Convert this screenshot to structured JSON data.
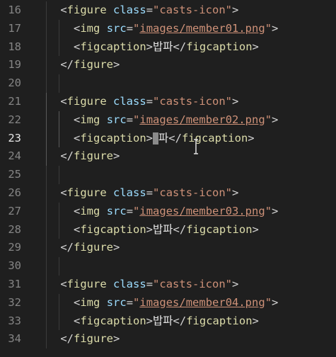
{
  "editor": {
    "active_line": 23,
    "lines": [
      {
        "number": "16",
        "indent": "    ",
        "parts": [
          [
            "bracket",
            "<"
          ],
          [
            "tag",
            "figure"
          ],
          [
            "text",
            " "
          ],
          [
            "attr",
            "class"
          ],
          [
            "bracket",
            "="
          ],
          [
            "str",
            "\"casts-icon\""
          ],
          [
            "bracket",
            ">"
          ]
        ]
      },
      {
        "number": "17",
        "indent": "      ",
        "parts": [
          [
            "bracket",
            "<"
          ],
          [
            "tag",
            "img"
          ],
          [
            "text",
            " "
          ],
          [
            "attr",
            "src"
          ],
          [
            "bracket",
            "="
          ],
          [
            "str",
            "\""
          ],
          [
            "link",
            "images/member01.png"
          ],
          [
            "str",
            "\""
          ],
          [
            "bracket",
            ">"
          ]
        ]
      },
      {
        "number": "18",
        "indent": "      ",
        "parts": [
          [
            "bracket",
            "<"
          ],
          [
            "tag",
            "figcaption"
          ],
          [
            "bracket",
            ">"
          ],
          [
            "text",
            "밥파"
          ],
          [
            "bracket",
            "</"
          ],
          [
            "tag",
            "figcaption"
          ],
          [
            "bracket",
            ">"
          ]
        ]
      },
      {
        "number": "19",
        "indent": "    ",
        "parts": [
          [
            "bracket",
            "</"
          ],
          [
            "tag",
            "figure"
          ],
          [
            "bracket",
            ">"
          ]
        ]
      },
      {
        "number": "20",
        "indent": "",
        "parts": []
      },
      {
        "number": "21",
        "indent": "    ",
        "parts": [
          [
            "bracket",
            "<"
          ],
          [
            "tag",
            "figure"
          ],
          [
            "text",
            " "
          ],
          [
            "attr",
            "class"
          ],
          [
            "bracket",
            "="
          ],
          [
            "str",
            "\"casts-icon\""
          ],
          [
            "bracket",
            ">"
          ]
        ]
      },
      {
        "number": "22",
        "indent": "      ",
        "parts": [
          [
            "bracket",
            "<"
          ],
          [
            "tag",
            "img"
          ],
          [
            "text",
            " "
          ],
          [
            "attr",
            "src"
          ],
          [
            "bracket",
            "="
          ],
          [
            "str",
            "\""
          ],
          [
            "link",
            "images/member02.png"
          ],
          [
            "str",
            "\""
          ],
          [
            "bracket",
            ">"
          ]
        ]
      },
      {
        "number": "23",
        "indent": "      ",
        "parts": [
          [
            "bracket",
            "<"
          ],
          [
            "tag",
            "figcaption"
          ],
          [
            "bracket",
            ">"
          ],
          [
            "cursor",
            ""
          ],
          [
            "text",
            "파"
          ],
          [
            "bracket",
            "</"
          ],
          [
            "tag",
            "figcaption"
          ],
          [
            "bracket",
            ">"
          ]
        ]
      },
      {
        "number": "24",
        "indent": "    ",
        "parts": [
          [
            "bracket",
            "</"
          ],
          [
            "tag",
            "figure"
          ],
          [
            "bracket",
            ">"
          ]
        ]
      },
      {
        "number": "25",
        "indent": "",
        "parts": []
      },
      {
        "number": "26",
        "indent": "    ",
        "parts": [
          [
            "bracket",
            "<"
          ],
          [
            "tag",
            "figure"
          ],
          [
            "text",
            " "
          ],
          [
            "attr",
            "class"
          ],
          [
            "bracket",
            "="
          ],
          [
            "str",
            "\"casts-icon\""
          ],
          [
            "bracket",
            ">"
          ]
        ]
      },
      {
        "number": "27",
        "indent": "      ",
        "parts": [
          [
            "bracket",
            "<"
          ],
          [
            "tag",
            "img"
          ],
          [
            "text",
            " "
          ],
          [
            "attr",
            "src"
          ],
          [
            "bracket",
            "="
          ],
          [
            "str",
            "\""
          ],
          [
            "link",
            "images/member03.png"
          ],
          [
            "str",
            "\""
          ],
          [
            "bracket",
            ">"
          ]
        ]
      },
      {
        "number": "28",
        "indent": "      ",
        "parts": [
          [
            "bracket",
            "<"
          ],
          [
            "tag",
            "figcaption"
          ],
          [
            "bracket",
            ">"
          ],
          [
            "text",
            "밥파"
          ],
          [
            "bracket",
            "</"
          ],
          [
            "tag",
            "figcaption"
          ],
          [
            "bracket",
            ">"
          ]
        ]
      },
      {
        "number": "29",
        "indent": "    ",
        "parts": [
          [
            "bracket",
            "</"
          ],
          [
            "tag",
            "figure"
          ],
          [
            "bracket",
            ">"
          ]
        ]
      },
      {
        "number": "30",
        "indent": "",
        "parts": []
      },
      {
        "number": "31",
        "indent": "    ",
        "parts": [
          [
            "bracket",
            "<"
          ],
          [
            "tag",
            "figure"
          ],
          [
            "text",
            " "
          ],
          [
            "attr",
            "class"
          ],
          [
            "bracket",
            "="
          ],
          [
            "str",
            "\"casts-icon\""
          ],
          [
            "bracket",
            ">"
          ]
        ]
      },
      {
        "number": "32",
        "indent": "      ",
        "parts": [
          [
            "bracket",
            "<"
          ],
          [
            "tag",
            "img"
          ],
          [
            "text",
            " "
          ],
          [
            "attr",
            "src"
          ],
          [
            "bracket",
            "="
          ],
          [
            "str",
            "\""
          ],
          [
            "link",
            "images/member04.png"
          ],
          [
            "str",
            "\""
          ],
          [
            "bracket",
            ">"
          ]
        ]
      },
      {
        "number": "33",
        "indent": "      ",
        "parts": [
          [
            "bracket",
            "<"
          ],
          [
            "tag",
            "figcaption"
          ],
          [
            "bracket",
            ">"
          ],
          [
            "text",
            "밥파"
          ],
          [
            "bracket",
            "</"
          ],
          [
            "tag",
            "figcaption"
          ],
          [
            "bracket",
            ">"
          ]
        ]
      },
      {
        "number": "34",
        "indent": "    ",
        "parts": [
          [
            "bracket",
            "</"
          ],
          [
            "tag",
            "figure"
          ],
          [
            "bracket",
            ">"
          ]
        ]
      }
    ],
    "colors": {
      "background": "#1f1f1f",
      "line_number": "#858585",
      "line_number_active": "#e6e6e6",
      "tag": "#dcdcaa",
      "attribute": "#9cdcfe",
      "string": "#ce9178",
      "text": "#e6e6e6"
    },
    "mouse_cursor_icon": "text-cursor-icon"
  }
}
